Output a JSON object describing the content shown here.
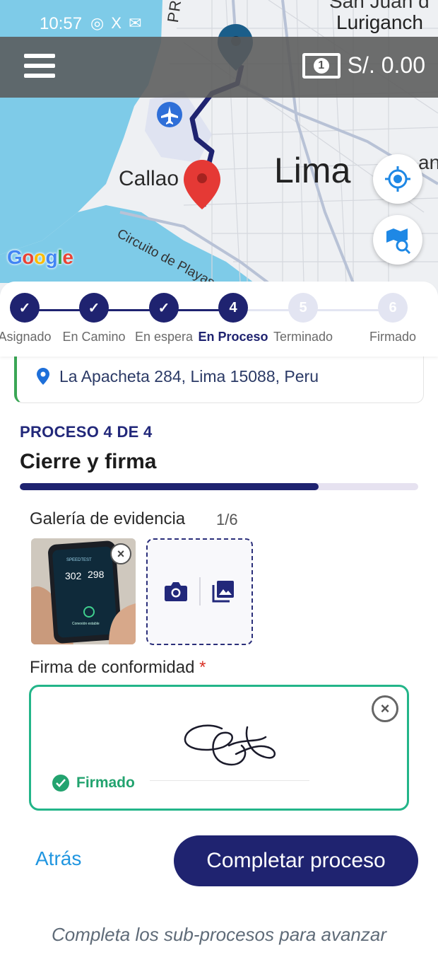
{
  "status_bar": {
    "time": "10:57",
    "icons": "◎ X ✉"
  },
  "top_bar": {
    "balance": "S/. 0.00",
    "cash_icon_digit": "1"
  },
  "map": {
    "labels": {
      "lima": "Lima",
      "callao": "Callao",
      "provi": "PROVI",
      "circuito": "Circuito de Playas",
      "san_juan": "San Juan d",
      "lurigancho": "Luriganch",
      "an": "an"
    },
    "google": {
      "g1": "G",
      "g2": "o",
      "g3": "o",
      "g4": "g",
      "g5": "l",
      "g6": "e"
    },
    "colors": {
      "sea": "#7ecbe8",
      "route": "#1f2370",
      "origin_pin": "#1b5e8a",
      "dest_pin": "#e53935"
    }
  },
  "stepper": {
    "steps": [
      {
        "number": "✓",
        "label": "Asignado",
        "state": "done"
      },
      {
        "number": "✓",
        "label": "En Camino",
        "state": "done"
      },
      {
        "number": "✓",
        "label": "En espera",
        "state": "done"
      },
      {
        "number": "4",
        "label": "En Proceso",
        "state": "current"
      },
      {
        "number": "5",
        "label": "Terminado",
        "state": "todo"
      },
      {
        "number": "6",
        "label": "Firmado",
        "state": "todo"
      }
    ]
  },
  "address": {
    "text": "La Apacheta 284, Lima 15088, Peru"
  },
  "process": {
    "step_label": "PROCESO 4 DE 4",
    "title": "Cierre y firma",
    "progress": 0.75
  },
  "gallery": {
    "label": "Galería de evidencia",
    "count": "1/6",
    "photo": {
      "brand": "SPEEDTEST",
      "down": "302",
      "up": "298",
      "status": "Conexión estable"
    }
  },
  "signature": {
    "label": "Firma de conformidad",
    "required_mark": "*",
    "status": "Firmado"
  },
  "actions": {
    "back": "Atrás",
    "complete": "Completar proceso"
  },
  "hint": "Completa los sub-procesos para avanzar",
  "colors": {
    "primary": "#1f2370",
    "success": "#23b589",
    "link": "#2196e0"
  }
}
